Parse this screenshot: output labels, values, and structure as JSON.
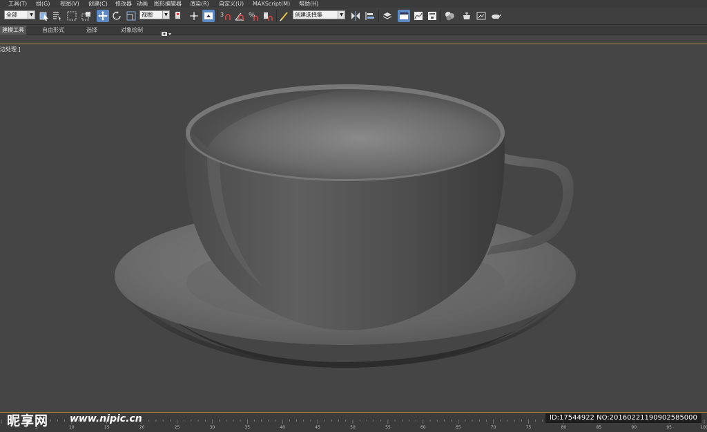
{
  "menubar": {
    "items": [
      {
        "label": "工具(T)"
      },
      {
        "label": "组(G)"
      },
      {
        "label": "视图(V)"
      },
      {
        "label": "创建(C)"
      },
      {
        "label": "修改器"
      },
      {
        "label": "动画"
      },
      {
        "label": "图形编辑器"
      },
      {
        "label": "渲染(R)"
      },
      {
        "label": "自定义(U)"
      },
      {
        "label": "MAXScript(M)"
      },
      {
        "label": "帮助(H)"
      }
    ]
  },
  "toolbar": {
    "selection_filter": "全部",
    "coord_system": "视图",
    "named_selection_set": "创建选择集",
    "snap_angle_label": "3",
    "percent_snap_label": "%",
    "icons": [
      "select-object-icon",
      "select-by-name-icon",
      "rectangular-region-icon",
      "window-crossing-icon",
      "select-and-move-icon",
      "select-and-rotate-icon",
      "select-and-scale-icon",
      "use-pivot-center-icon",
      "select-manipulate-icon",
      "keyboard-shortcut-icon",
      "snap-toggle-icon",
      "angle-snap-icon",
      "percent-snap-icon",
      "spinner-snap-icon",
      "edit-named-selection-icon",
      "mirror-icon",
      "align-icon",
      "layer-manager-icon",
      "ribbon-toggle-icon",
      "curve-editor-icon",
      "schematic-view-icon",
      "material-editor-icon",
      "render-setup-icon",
      "rendered-frame-window-icon",
      "render-production-icon"
    ]
  },
  "ribbon": {
    "tabs": [
      {
        "label": "建模工具"
      },
      {
        "label": "自由形式"
      },
      {
        "label": "选择"
      },
      {
        "label": "对象绘制"
      }
    ]
  },
  "viewport": {
    "label": "边处理 ]"
  },
  "timeline": {
    "ticks": [
      "5",
      "10",
      "15",
      "20",
      "25",
      "30",
      "35",
      "40",
      "45",
      "50",
      "55",
      "60",
      "65",
      "70",
      "75",
      "80",
      "85",
      "90",
      "95",
      "100"
    ]
  },
  "watermark": {
    "logo": "昵享网",
    "url": "www.nipic.cn",
    "id_text": "ID:17544922 NO:20160221190902585000"
  },
  "colors": {
    "ui_bg": "#3f3f3f",
    "viewport_bg": "#454545",
    "accent_blue": "#5b87c3",
    "frame_orange": "#b8873b"
  }
}
